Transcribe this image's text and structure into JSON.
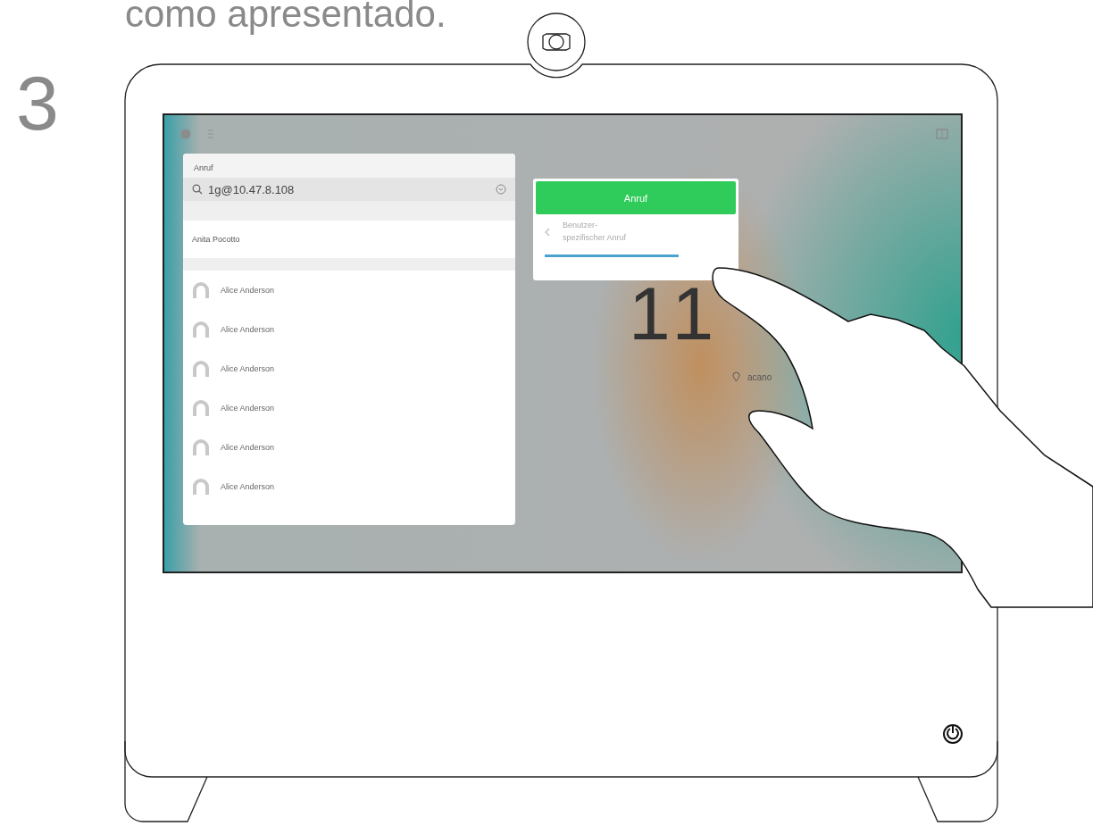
{
  "instruction": "como apresentado.",
  "step": "3",
  "panel": {
    "title": "Anruf",
    "search": {
      "value": "1g@10.47.8.108"
    },
    "recent": {
      "name": "Anita Pocotto"
    },
    "contacts": [
      {
        "name": "Alice Anderson"
      },
      {
        "name": "Alice Anderson"
      },
      {
        "name": "Alice Anderson"
      },
      {
        "name": "Alice Anderson"
      },
      {
        "name": "Alice Anderson"
      },
      {
        "name": "Alice Anderson"
      }
    ]
  },
  "popup": {
    "button": "Anruf",
    "option": "Benutzer-\nspezifischer Anruf"
  },
  "clock": {
    "visible_parts": [
      "11"
    ]
  },
  "location": "acano"
}
